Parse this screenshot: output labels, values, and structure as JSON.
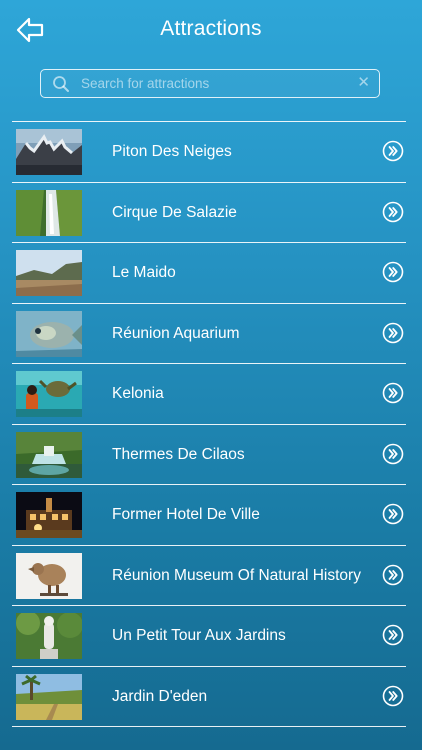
{
  "header": {
    "title": "Attractions",
    "back_icon": "back-arrow-icon"
  },
  "search": {
    "placeholder": "Search for attractions",
    "value": "",
    "icon": "search-icon",
    "clear_icon": "clear-icon"
  },
  "colors": {
    "background_top": "#2ea6d8",
    "background_bottom": "#156a90",
    "text": "#ffffff",
    "divider": "#ffffff"
  },
  "attractions": [
    {
      "label": "Piton Des Neiges",
      "thumbnail": "mountain-peaks-photo"
    },
    {
      "label": "Cirque De Salazie",
      "thumbnail": "waterfall-photo"
    },
    {
      "label": "Le Maido",
      "thumbnail": "ridge-landscape-photo"
    },
    {
      "label": "Réunion Aquarium",
      "thumbnail": "fish-photo"
    },
    {
      "label": "Kelonia",
      "thumbnail": "sea-turtle-photo"
    },
    {
      "label": "Thermes De Cilaos",
      "thumbnail": "jungle-pool-photo"
    },
    {
      "label": "Former Hotel De Ville",
      "thumbnail": "night-building-photo"
    },
    {
      "label": "Réunion Museum Of Natural History",
      "thumbnail": "dodo-bird-photo"
    },
    {
      "label": "Un Petit Tour Aux Jardins",
      "thumbnail": "garden-statue-photo"
    },
    {
      "label": "Jardin D'eden",
      "thumbnail": "tropical-garden-photo"
    }
  ]
}
